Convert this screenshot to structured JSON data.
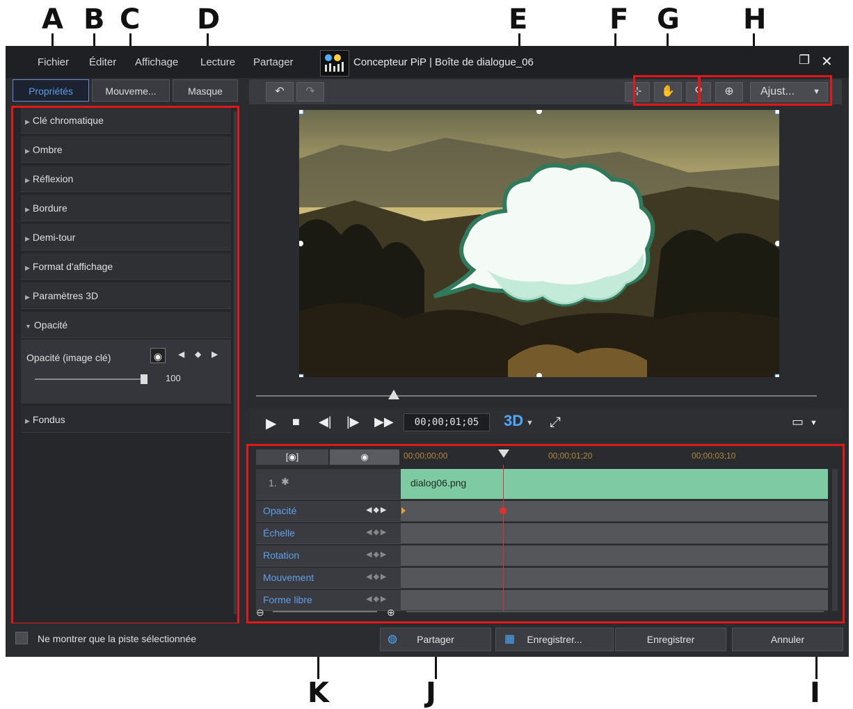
{
  "callouts": [
    "A",
    "B",
    "C",
    "D",
    "E",
    "F",
    "G",
    "H",
    "I",
    "J",
    "K"
  ],
  "menu": [
    "Fichier",
    "Éditer",
    "Affichage",
    "Lecture",
    "Partager"
  ],
  "window_title": "Concepteur PiP | Boîte de dialogue_06",
  "tabs": [
    "Propriétés",
    "Mouveme...",
    "Masque"
  ],
  "properties": [
    "Clé chromatique",
    "Ombre",
    "Réflexion",
    "Bordure",
    "Demi-tour",
    "Format d'affichage",
    "Paramètres 3D",
    "Opacité"
  ],
  "opacity_panel": {
    "label": "Opacité (image clé)",
    "value": "100"
  },
  "fondus": "Fondus",
  "zoom_select": "Ajust...",
  "timecode": "00;00;01;05",
  "mode_3d": "3D",
  "timeline": {
    "ruler": [
      "00;00;00;00",
      "00;00;01;20",
      "00;00;03;10"
    ],
    "track_index": "1.",
    "clip_name": "dialog06.png",
    "tracks": [
      "Opacité",
      "Échelle",
      "Rotation",
      "Mouvement",
      "Forme libre"
    ]
  },
  "footer": {
    "checkbox_label": "Ne montrer que la piste sélectionnée",
    "share": "Partager",
    "save_as": "Enregistrer...",
    "save": "Enregistrer",
    "cancel": "Annuler"
  }
}
